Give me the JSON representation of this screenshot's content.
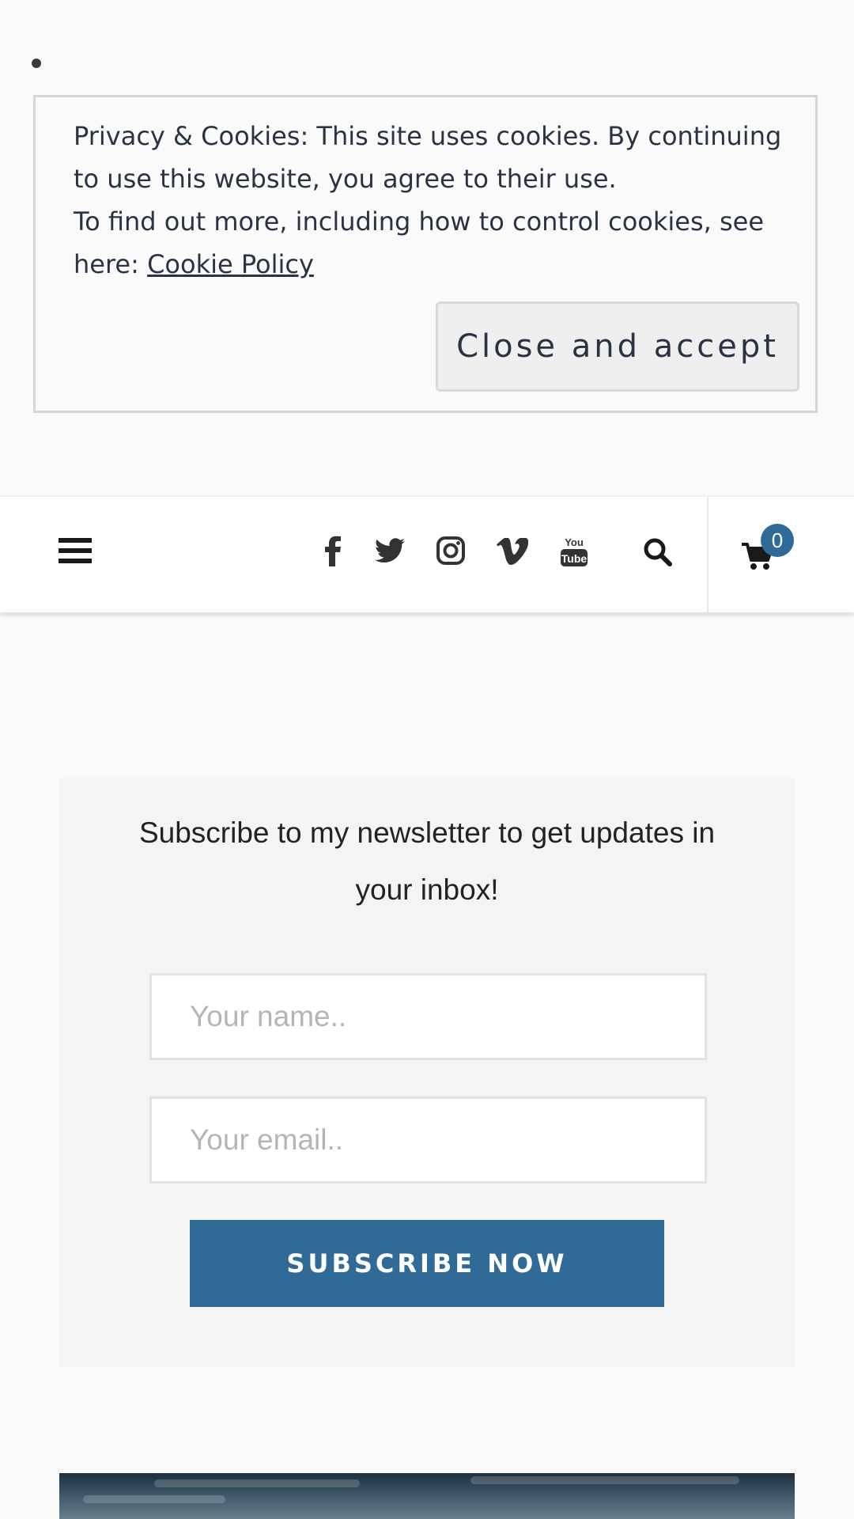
{
  "cookie_notice": {
    "line1": "Privacy & Cookies: This site uses cookies. By continuing to use this website, you agree to their use.",
    "line2_prefix": "To find out more, including how to control cookies, see here: ",
    "policy_link": "Cookie Policy",
    "close_button": "Close and accept"
  },
  "header": {
    "menu_icon": "hamburger-menu-icon",
    "social_icons": [
      "facebook-icon",
      "twitter-icon",
      "instagram-icon",
      "vimeo-icon",
      "youtube-icon"
    ],
    "search_icon": "search-icon",
    "cart_icon": "cart-icon",
    "cart_count": "0",
    "accent_color": "#2f6b98"
  },
  "newsletter": {
    "heading": "Subscribe to my newsletter to get updates in your inbox!",
    "name_placeholder": "Your name..",
    "email_placeholder": "Your email..",
    "button_label": "SUBSCRIBE NOW",
    "button_color": "#306b98"
  }
}
